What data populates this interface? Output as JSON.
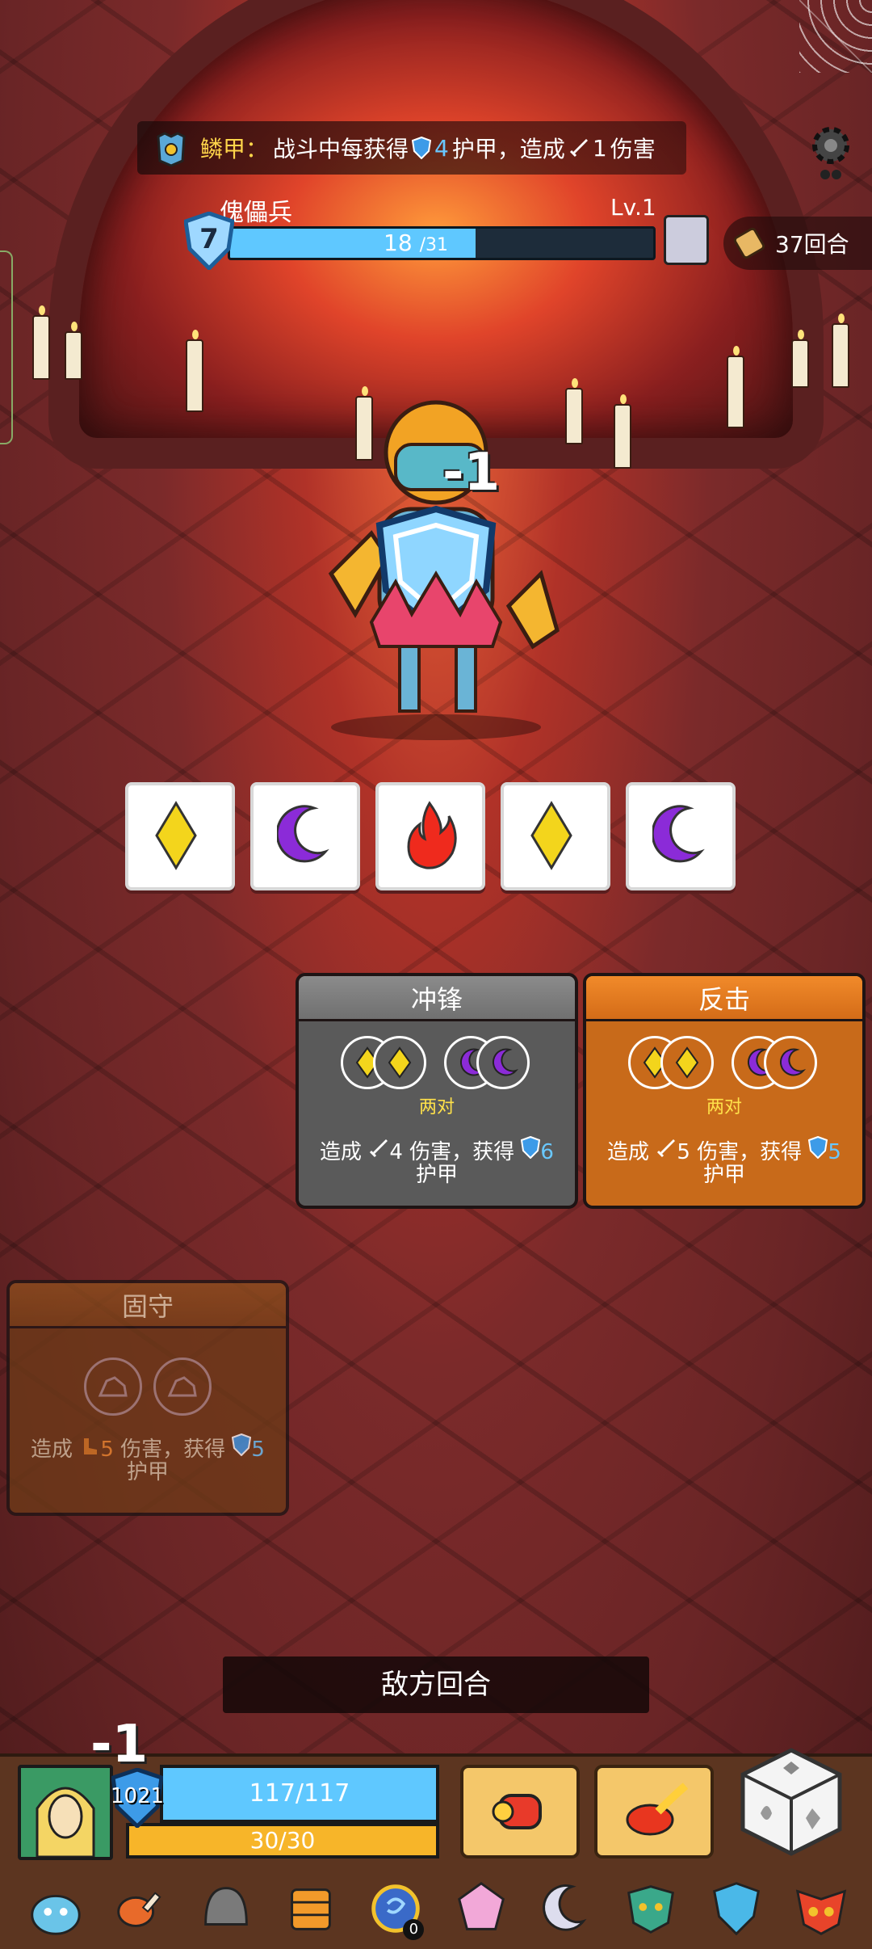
{
  "banner": {
    "relic_name": "鳞甲：",
    "relic_desc_1": "战斗中每获得",
    "relic_armor_value": "4",
    "relic_desc_2": "护甲，造成",
    "relic_damage_value": "1",
    "relic_desc_3": "伤害"
  },
  "enemy": {
    "name": "傀儡兵",
    "level": "Lv.1",
    "armor": "7",
    "hp": "18",
    "hp_max": "/31",
    "hp_fraction": 0.58,
    "floating_damage": "-1"
  },
  "round": {
    "label": "37回合"
  },
  "rolled_dice": [
    {
      "symbol": "diamond",
      "color": "#f3d51c"
    },
    {
      "symbol": "moon",
      "color": "#8b2bd8"
    },
    {
      "symbol": "flame",
      "color": "#ef2a1d"
    },
    {
      "symbol": "diamond",
      "color": "#f3d51c"
    },
    {
      "symbol": "moon",
      "color": "#8b2bd8"
    }
  ],
  "skills": {
    "charge": {
      "title": "冲锋",
      "combo": "两对",
      "effect_a": "造成",
      "damage": "4",
      "effect_b": "伤害，获得",
      "armor": "6",
      "effect_c": "护甲"
    },
    "counter": {
      "title": "反击",
      "combo": "两对",
      "effect_a": "造成",
      "damage": "5",
      "effect_b": "伤害，获得",
      "armor": "5",
      "effect_c": "护甲"
    },
    "guard": {
      "title": "固守",
      "effect_a": "造成",
      "damage": "5",
      "effect_b": "伤害，获得",
      "armor": "5",
      "effect_c": "护甲"
    }
  },
  "enemy_turn_label": "敌方回合",
  "player": {
    "armor": "1021",
    "hp": "117/117",
    "energy": "30/30",
    "floating_damage": "-1"
  },
  "inventory": [
    {
      "icon": "slime-icon"
    },
    {
      "icon": "meat-icon"
    },
    {
      "icon": "helmet-icon"
    },
    {
      "icon": "totem-icon"
    },
    {
      "icon": "rune-coin-icon",
      "count": "0"
    },
    {
      "icon": "crystal-die-icon"
    },
    {
      "icon": "moon-star-icon"
    },
    {
      "icon": "demon-mask-icon"
    },
    {
      "icon": "blue-shield-icon"
    },
    {
      "icon": "tribal-mask-icon"
    }
  ],
  "colors": {
    "armor_blue": "#69c8ff",
    "hp_blue": "#5fc8ff",
    "energy_yellow": "#f7b529",
    "gold_text": "#ffd54a",
    "combo_yellow": "#ffe14a"
  }
}
